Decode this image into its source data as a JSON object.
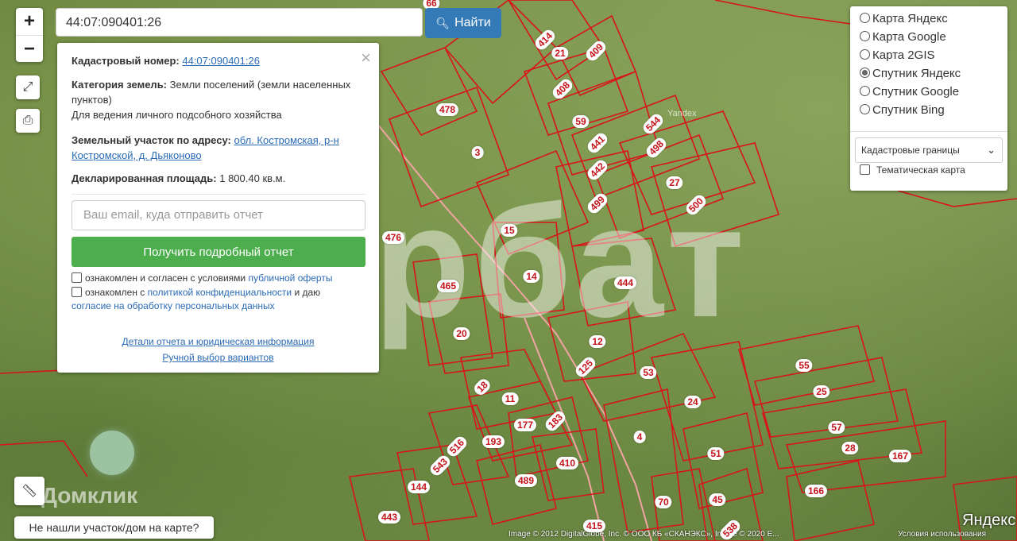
{
  "search": {
    "value": "44:07:090401:26",
    "button_label": "Найти",
    "button_icon": "search-icon"
  },
  "zoom": {
    "in_label": "+",
    "out_label": "−"
  },
  "controls": {
    "fullscreen_icon": "expand-icon",
    "print_icon": "printer-icon",
    "ruler_icon": "ruler-icon"
  },
  "info": {
    "cadastral_label": "Кадастровый номер:",
    "cadastral_value": "44:07:090401:26",
    "category_label": "Категория земель:",
    "category_value": "Земли поселений (земли населенных пунктов)",
    "usage": "Для ведения личного подсобного хозяйства",
    "address_label": "Земельный участок по адресу:",
    "address_value": "обл. Костромская, р-н Костромской, д. Дьяконово",
    "area_label": "Декларированная площадь:",
    "area_value": "1 800.40",
    "area_unit": "кв.м.",
    "email_placeholder": "Ваш email, куда отправить отчет",
    "report_button": "Получить подробный отчет",
    "consent1_prefix": "ознакомлен и согласен с условиями",
    "consent1_link": "публичной оферты",
    "consent2_prefix": "ознакомлен с",
    "consent2_link": "политикой конфиденциальности",
    "consent2_mid": "и даю",
    "consent2_link2": "согласие на обработку персональных данных",
    "details_link": "Детали отчета и юридическая информация",
    "manual_link": "Ручной выбор вариантов",
    "close_label": "×"
  },
  "layers": {
    "options": [
      {
        "label": "Карта Яндекс",
        "selected": false
      },
      {
        "label": "Карта Google",
        "selected": false
      },
      {
        "label": "Карта 2GIS",
        "selected": false
      },
      {
        "label": "Спутник Яндекс",
        "selected": true
      },
      {
        "label": "Спутник Google",
        "selected": false
      },
      {
        "label": "Спутник Bing",
        "selected": false
      }
    ],
    "select_value": "Кадастровые границы",
    "thematic_label": "Тематическая карта"
  },
  "map": {
    "watermark": "рбат",
    "domclick": "Домклик",
    "yandex_small": "Yandex",
    "yandex_logo": "Яндекс",
    "copyright": "Image © 2012 DigitalGlobe, Inc. © ООО КБ «СКАНЭКС», Image © 2020 Е...",
    "terms": "Условия использования",
    "parcels": [
      "66",
      "414",
      "21",
      "409",
      "408",
      "478",
      "59",
      "544",
      "441",
      "498",
      "3",
      "442",
      "27",
      "500",
      "499",
      "15",
      "476",
      "465",
      "14",
      "444",
      "20",
      "12",
      "125",
      "53",
      "55",
      "18",
      "11",
      "25",
      "24",
      "177",
      "183",
      "57",
      "193",
      "516",
      "4",
      "28",
      "167",
      "543",
      "410",
      "51",
      "489",
      "144",
      "166",
      "70",
      "45",
      "443",
      "415",
      "538"
    ]
  },
  "not_found_button": "Не нашли участок/дом на карте?"
}
